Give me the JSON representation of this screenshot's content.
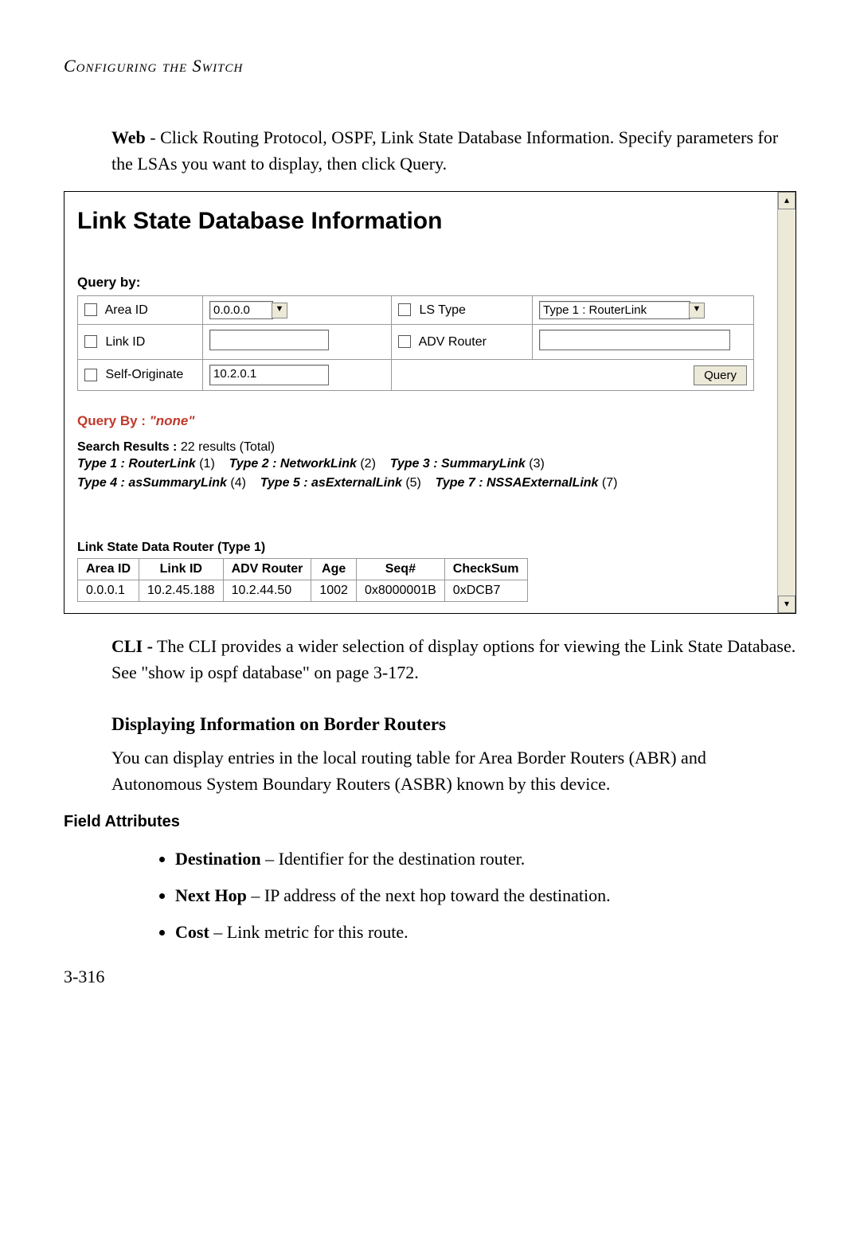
{
  "heading": "Configuring the Switch",
  "intro_bold": "Web",
  "intro_rest": " - Click Routing Protocol, OSPF, Link State Database Information. Specify parameters for the LSAs you want to display, then click Query.",
  "panel": {
    "title": "Link State Database Information",
    "query_by_label": "Query by:",
    "rows": {
      "area_id": {
        "label": "Area ID",
        "value": "0.0.0.0"
      },
      "ls_type": {
        "label": "LS Type",
        "value": "Type 1 : RouterLink"
      },
      "link_id": {
        "label": "Link ID",
        "value": ""
      },
      "adv_router": {
        "label": "ADV Router",
        "value": ""
      },
      "self_originate": {
        "label": "Self-Originate",
        "value": "10.2.0.1"
      }
    },
    "query_button": "Query",
    "query_by_none_label": "Query By : ",
    "query_by_none_value": "\"none\"",
    "search_results_label": "Search Results :",
    "search_results_value": " 22 results (Total)",
    "types_line1": [
      {
        "name": "Type 1 : RouterLink",
        "num": "(1)"
      },
      {
        "name": "Type 2 : NetworkLink",
        "num": "(2)"
      },
      {
        "name": "Type 3 : SummaryLink",
        "num": "(3)"
      }
    ],
    "types_line2": [
      {
        "name": "Type 4 : asSummaryLink",
        "num": "(4)"
      },
      {
        "name": "Type 5 : asExternalLink",
        "num": "(5)"
      },
      {
        "name": "Type 7 : NSSAExternalLink",
        "num": "(7)"
      }
    ],
    "data_title": "Link State Data Router (Type 1)",
    "data_headers": [
      "Area ID",
      "Link ID",
      "ADV Router",
      "Age",
      "Seq#",
      "CheckSum"
    ],
    "data_row": [
      "0.0.0.1",
      "10.2.45.188",
      "10.2.44.50",
      "1002",
      "0x8000001B",
      "0xDCB7"
    ]
  },
  "cli_bold": "CLI -",
  "cli_rest": " The CLI provides a wider selection of display options for viewing the Link State Database. See \"show ip ospf database\" on page 3-172.",
  "subsection": "Displaying Information on Border Routers",
  "sub_body": "You can display entries in the local routing table for Area Border Routers (ABR) and Autonomous System Boundary Routers (ASBR) known by this device.",
  "field_attr_heading": "Field Attributes",
  "attrs": [
    {
      "name": "Destination",
      "desc": " – Identifier for the destination router."
    },
    {
      "name": "Next Hop",
      "desc": " – IP address of the next hop toward the destination."
    },
    {
      "name": "Cost",
      "desc": " – Link metric for this route."
    }
  ],
  "page_num": "3-316"
}
